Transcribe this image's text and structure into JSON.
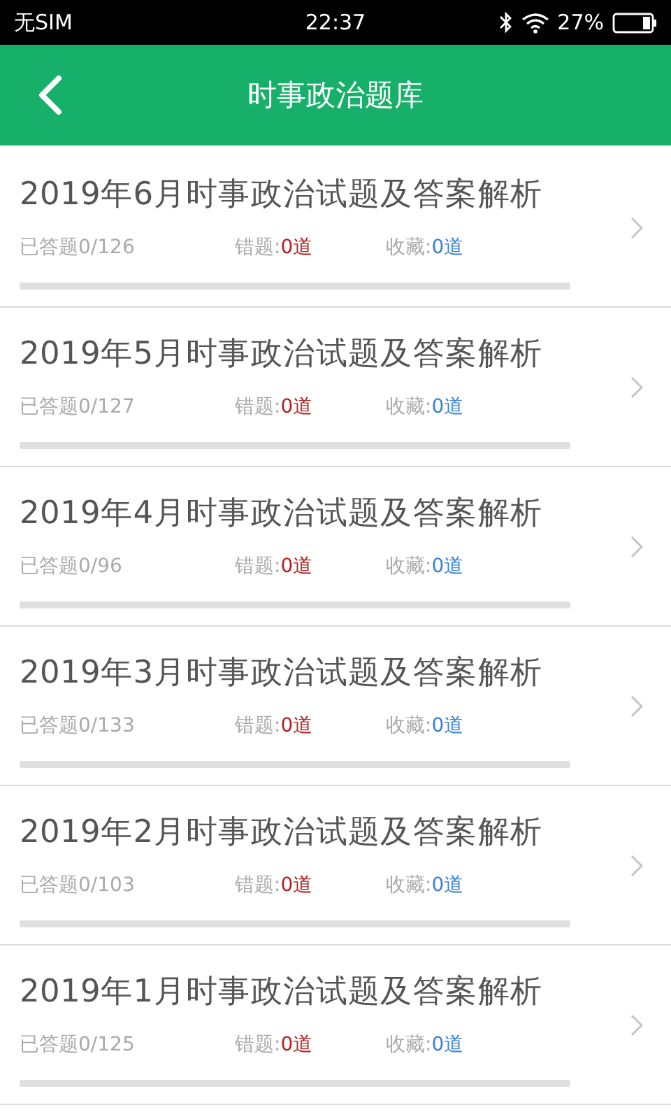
{
  "status_bar": {
    "carrier": "无SIM",
    "time": "22:37",
    "battery": "27%"
  },
  "header": {
    "title": "时事政治题库"
  },
  "items": [
    {
      "title": "2019年6月时事政治试题及答案解析",
      "answered": "已答题0/126",
      "wrong_label": "错题:",
      "wrong": "0道",
      "fav_label": "收藏:",
      "fav": "0道",
      "level": 0
    },
    {
      "title": "2019年5月时事政治试题及答案解析",
      "answered": "已答题0/127",
      "wrong_label": "错题:",
      "wrong": "0道",
      "fav_label": "收藏:",
      "fav": "0道",
      "level": 0
    },
    {
      "title": "2019年4月时事政治试题及答案解析",
      "answered": "已答题0/96",
      "wrong_label": "错题:",
      "wrong": "0道",
      "fav_label": "收藏:",
      "fav": "0道",
      "level": 0
    },
    {
      "title": "2019年3月时事政治试题及答案解析",
      "answered": "已答题0/133",
      "wrong_label": "错题:",
      "wrong": "0道",
      "fav_label": "收藏:",
      "fav": "0道",
      "level": 0
    },
    {
      "title": "2019年2月时事政治试题及答案解析",
      "answered": "已答题0/103",
      "wrong_label": "错题:",
      "wrong": "0道",
      "fav_label": "收藏:",
      "fav": "0道",
      "level": 0
    },
    {
      "title": "2019年1月时事政治试题及答案解析",
      "answered": "已答题0/125",
      "wrong_label": "错题:",
      "wrong": "0道",
      "fav_label": "收藏:",
      "fav": "0道",
      "level": 0
    }
  ]
}
